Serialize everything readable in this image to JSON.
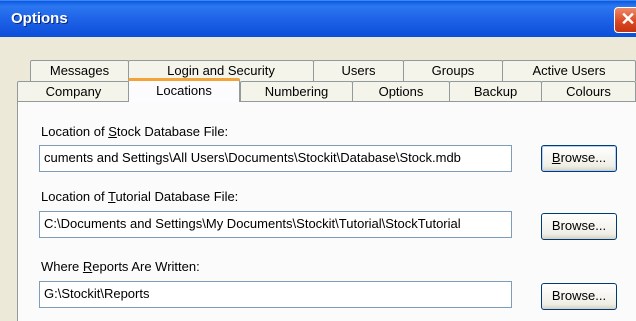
{
  "window": {
    "title": "Options",
    "close_glyph": "✕"
  },
  "tabs_row1": [
    {
      "label": "Messages"
    },
    {
      "label": "Login and Security"
    },
    {
      "label": "Users"
    },
    {
      "label": "Groups"
    },
    {
      "label": "Active Users"
    }
  ],
  "tabs_row2": [
    {
      "label": "Company"
    },
    {
      "label": "Locations",
      "active": true
    },
    {
      "label": "Numbering"
    },
    {
      "label": "Options"
    },
    {
      "label": "Backup"
    },
    {
      "label": "Colours"
    }
  ],
  "locations": {
    "stock_db": {
      "label_pre": "Location of ",
      "label_key": "S",
      "label_post": "tock Database File:",
      "value": "cuments and Settings\\All Users\\Documents\\Stockit\\Database\\Stock.mdb",
      "browse_pre": "",
      "browse_key": "B",
      "browse_post": "rowse..."
    },
    "tutorial_db": {
      "label_pre": "Location of ",
      "label_key": "T",
      "label_post": "utorial Database File:",
      "value": "C:\\Documents and Settings\\My Documents\\Stockit\\Tutorial\\StockTutorial",
      "browse_label": "Browse..."
    },
    "reports": {
      "label_pre": "Where ",
      "label_key": "R",
      "label_post": "eports Are Written:",
      "value": "G:\\Stockit\\Reports",
      "browse_label": "Browse..."
    }
  }
}
